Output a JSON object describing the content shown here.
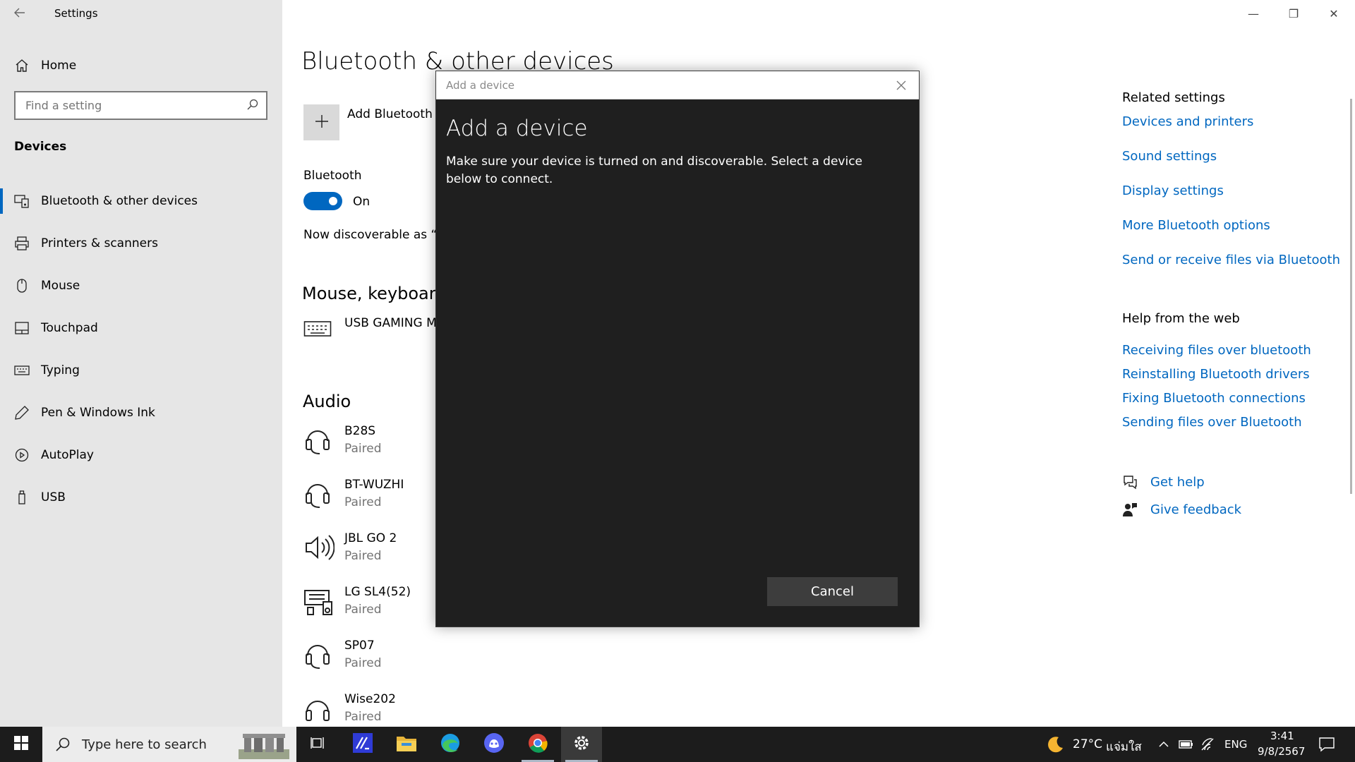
{
  "window": {
    "title": "Settings",
    "minimize_glyph": "—",
    "restore_glyph": "❐",
    "close_glyph": "✕"
  },
  "sidebar": {
    "home_label": "Home",
    "search_placeholder": "Find a setting",
    "section_title": "Devices",
    "items": [
      {
        "label": "Bluetooth & other devices",
        "icon": "bluetooth-devices-icon",
        "active": true
      },
      {
        "label": "Printers & scanners",
        "icon": "printer-icon"
      },
      {
        "label": "Mouse",
        "icon": "mouse-icon"
      },
      {
        "label": "Touchpad",
        "icon": "touchpad-icon"
      },
      {
        "label": "Typing",
        "icon": "keyboard-icon"
      },
      {
        "label": "Pen & Windows Ink",
        "icon": "pen-icon"
      },
      {
        "label": "AutoPlay",
        "icon": "autoplay-icon"
      },
      {
        "label": "USB",
        "icon": "usb-icon"
      }
    ]
  },
  "main": {
    "title": "Bluetooth & other devices",
    "add_label": "Add Bluetooth c",
    "bluetooth_label": "Bluetooth",
    "toggle_state": "On",
    "discoverable_text": "Now discoverable as “LA",
    "mouse_section": "Mouse, keyboard",
    "keyboard_device": "USB GAMING MC",
    "audio_section": "Audio",
    "audio_devices": [
      {
        "name": "B28S",
        "status": "Paired",
        "icon": "headset-icon"
      },
      {
        "name": "BT-WUZHI",
        "status": "Paired",
        "icon": "headset-icon"
      },
      {
        "name": "JBL GO 2",
        "status": "Paired",
        "icon": "speaker-icon"
      },
      {
        "name": "LG SL4(52)",
        "status": "Paired",
        "icon": "soundbar-icon"
      },
      {
        "name": "SP07",
        "status": "Paired",
        "icon": "headset-icon"
      },
      {
        "name": "Wise202",
        "status": "Paired",
        "icon": "headphones-icon"
      }
    ]
  },
  "related": {
    "heading": "Related settings",
    "links": [
      "Devices and printers",
      "Sound settings",
      "Display settings",
      "More Bluetooth options",
      "Send or receive files via Bluetooth"
    ]
  },
  "help": {
    "heading": "Help from the web",
    "links": [
      "Receiving files over bluetooth",
      "Reinstalling Bluetooth drivers",
      "Fixing Bluetooth connections",
      "Sending files over Bluetooth"
    ],
    "get_help": "Get help",
    "give_feedback": "Give feedback"
  },
  "dialog": {
    "window_title": "Add a device",
    "heading": "Add a device",
    "description": "Make sure your device is turned on and discoverable. Select a device below to connect.",
    "cancel_label": "Cancel"
  },
  "taskbar": {
    "search_placeholder": "Type here to search",
    "apps": [
      "task-view-icon",
      "app-icon",
      "file-explorer-icon",
      "edge-icon",
      "discord-icon",
      "chrome-icon",
      "settings-icon"
    ],
    "weather_temp": "27°C",
    "weather_text": "แจ่มใส",
    "language": "ENG",
    "time": "3:41",
    "date": "9/8/2567"
  },
  "colors": {
    "accent": "#0067c0",
    "sidebar_bg": "#e6e6e6",
    "dialog_bg": "#1f1f1f",
    "taskbar_bg": "#1c1c1c"
  }
}
